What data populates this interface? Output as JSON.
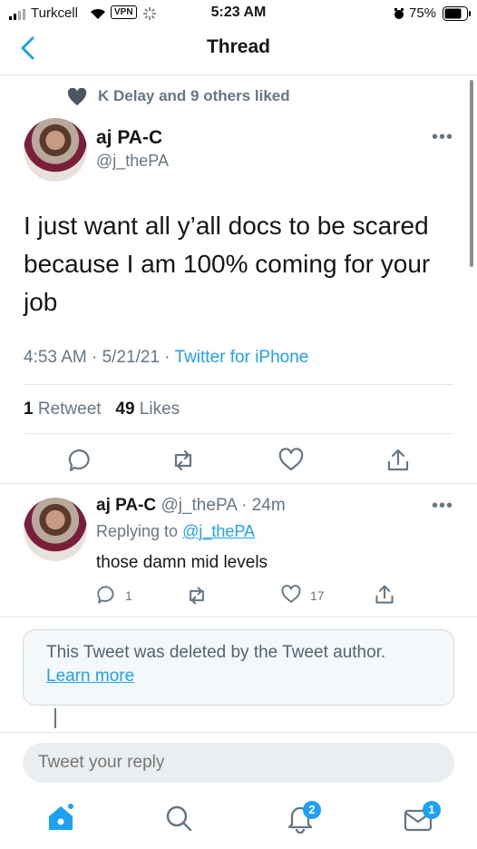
{
  "status_bar": {
    "carrier": "Turkcell",
    "vpn": "VPN",
    "time": "5:23 AM",
    "battery": "75%"
  },
  "header": {
    "title": "Thread"
  },
  "liked_by": "K Delay and 9 others liked",
  "tweet": {
    "name": "aj PA-C",
    "handle": "@j_thePA",
    "text": "I just want all y’all docs to be scared because I am 100% coming for your job",
    "time_date": "4:53 AM · 5/21/21 · ",
    "source": "Twitter for iPhone",
    "retweets": "1",
    "retweets_label": "Retweet",
    "likes": "49",
    "likes_label": "Likes"
  },
  "reply": {
    "name": "aj PA-C",
    "handle_time": "@j_thePA · 24m",
    "replying_prefix": "Replying to ",
    "replying_to": "@j_thePA",
    "text": "those damn mid levels",
    "reply_count": "1",
    "like_count": "17"
  },
  "deleted": {
    "text": "This Tweet was deleted by the Tweet author.",
    "link": "Learn more"
  },
  "compose": {
    "placeholder": "Tweet your reply"
  },
  "tabbar": {
    "notifications_badge": "2",
    "messages_badge": "1"
  },
  "colors": {
    "accent": "#1da1f2",
    "muted": "#657786"
  }
}
